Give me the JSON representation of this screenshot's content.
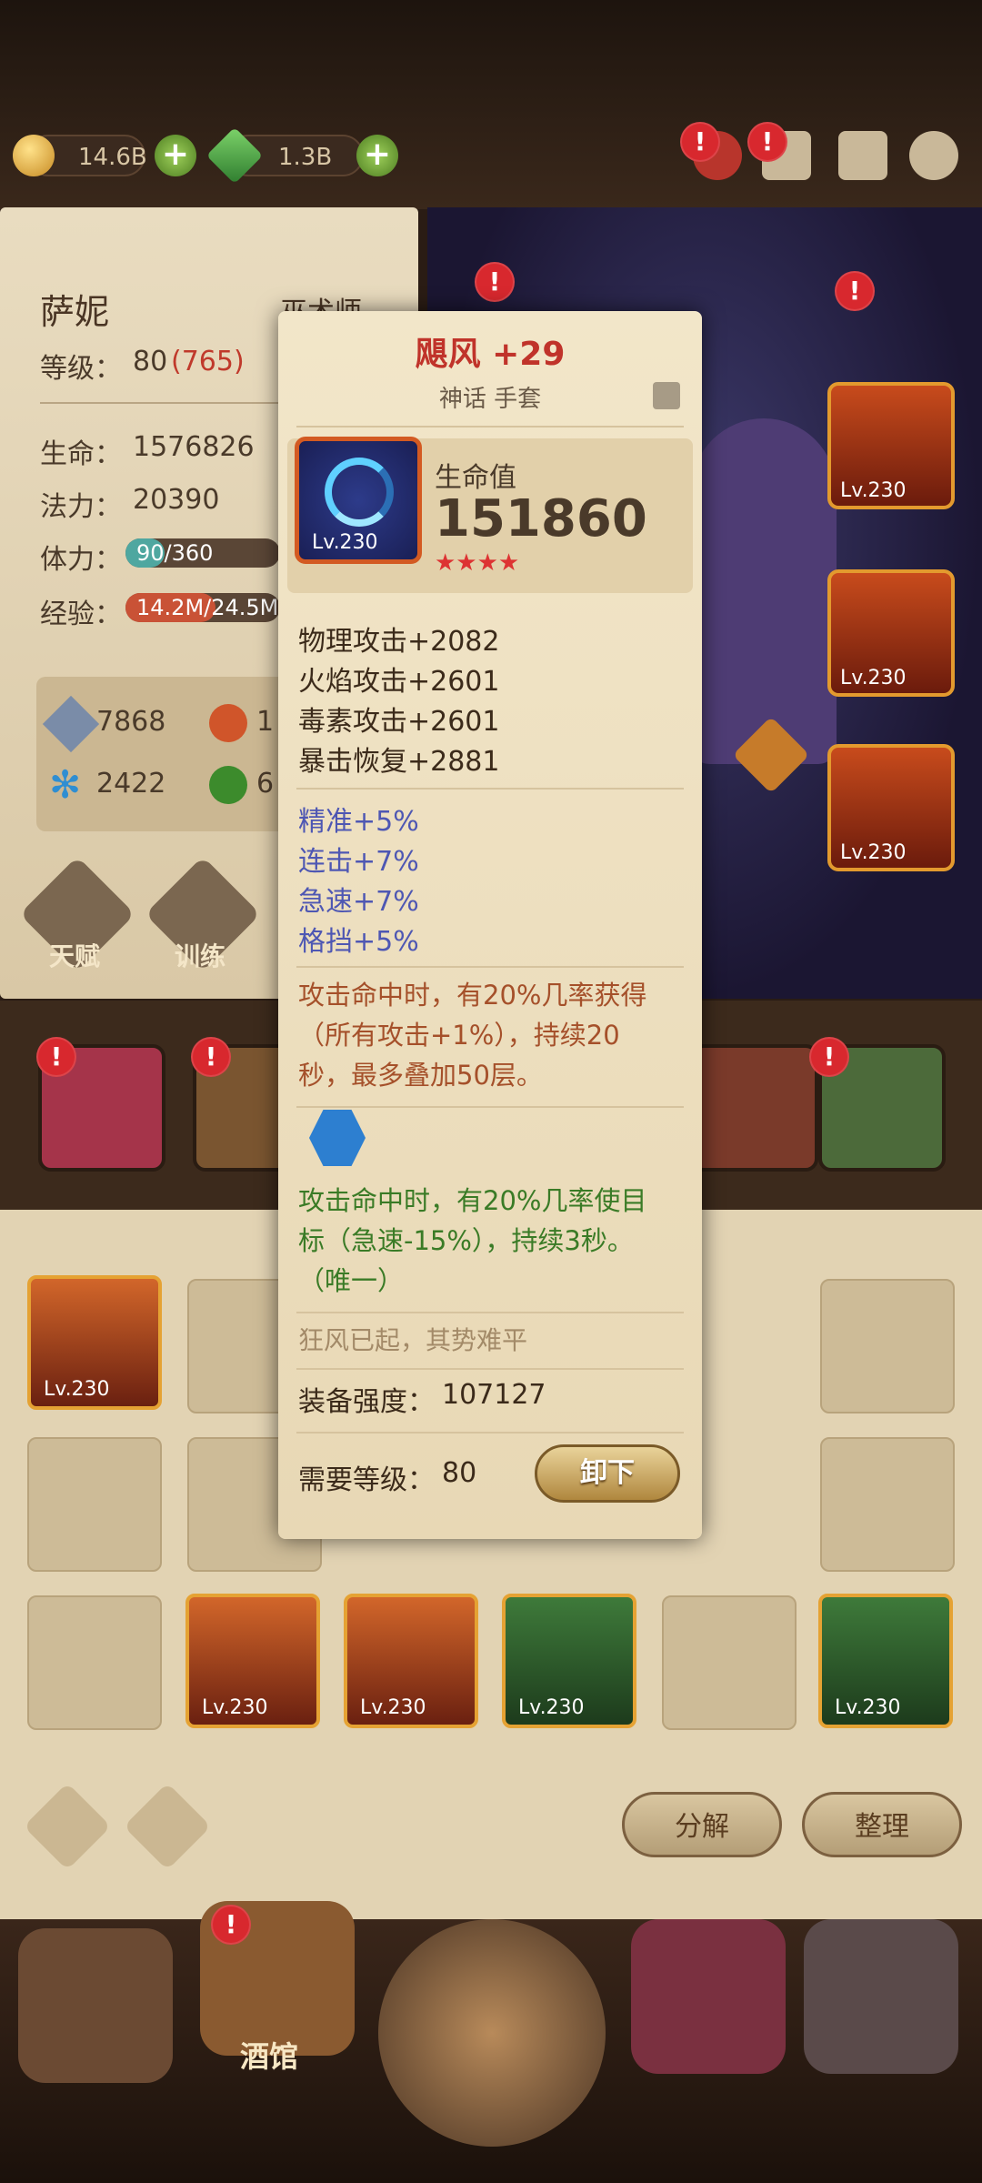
{
  "topbar": {
    "gold": "14.6B",
    "gems": "1.3B",
    "badge": "!"
  },
  "hero": {
    "name": "萨妮",
    "class": "巫术师",
    "level_label": "等级：",
    "level": "80",
    "level_extra": "(765)",
    "hp_label": "生命：",
    "hp": "1576826",
    "mp_label": "法力：",
    "mp": "20390",
    "stamina_label": "体力：",
    "stamina": "90/360",
    "stamina_fraction": 0.25,
    "exp_label": "经验：",
    "exp": "14.2M/24.5M",
    "exp_fraction": 0.58,
    "attr1": "7868",
    "attr2": "1",
    "attr3": "2422",
    "attr4": "6",
    "talent_btn": "天赋",
    "train_btn": "训练"
  },
  "equipment_right": {
    "lv1": "Lv.230",
    "lv2": "Lv.230",
    "lv3": "Lv.230"
  },
  "tooltip": {
    "title": "飓风 +29",
    "subtitle": "神话 手套",
    "item_level": "Lv.230",
    "main_stat_label": "生命值",
    "main_stat_value": "151860",
    "stars": "★★★★",
    "stats": [
      "物理攻击+2082",
      "火焰攻击+2601",
      "毒素攻击+2601",
      "暴击恢复+2881"
    ],
    "bonus": [
      "精准+5%",
      "连击+7%",
      "急速+7%",
      "格挡+5%"
    ],
    "effect1": [
      "攻击命中时，有20%几率获得",
      "（所有攻击+1%），持续20",
      "秒，最多叠加50层。"
    ],
    "effect2": [
      "攻击命中时，有20%几率使目",
      "标（急速-15%），持续3秒。",
      "（唯一）"
    ],
    "flavor": "狂风已起，其势难平",
    "power_label": "装备强度：",
    "power": "107127",
    "req_label": "需要等级：",
    "req_level": "80",
    "unequip_btn": "卸下"
  },
  "inventory": {
    "lv": "Lv.230",
    "decompose_btn": "分解",
    "sort_btn": "整理"
  },
  "nav": {
    "tavern": "酒馆"
  }
}
